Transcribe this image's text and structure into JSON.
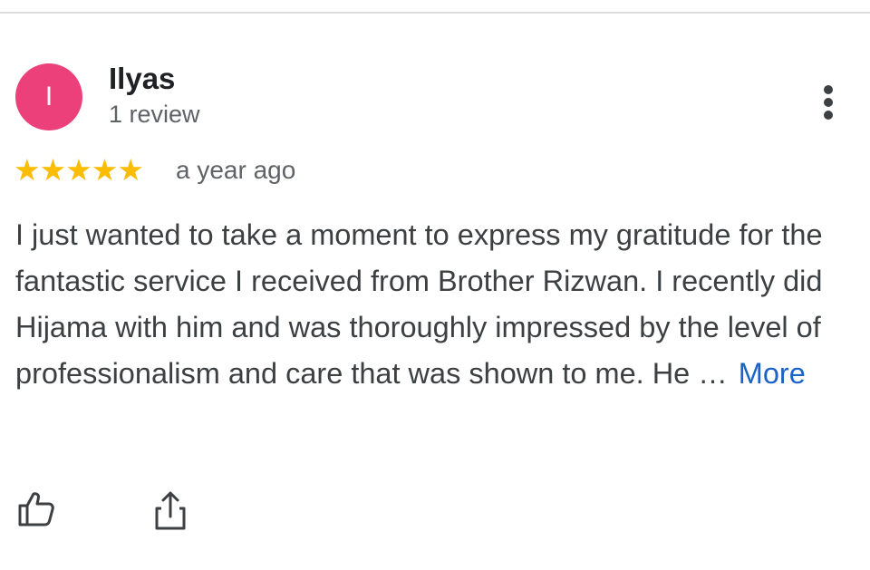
{
  "review": {
    "avatar_letter": "I",
    "avatar_color": "#ec407a",
    "reviewer_name": "Ilyas",
    "review_count": "1 review",
    "stars": "★★★★★",
    "rating": 5,
    "star_color": "#fbbc04",
    "time": "a year ago",
    "text": "I just wanted to take a moment to express my gratitude for the fantastic service I received from Brother Rizwan. I recently did Hijama with him and was thoroughly impressed by the level of professionalism and care that was shown to me. He …",
    "more_label": "More",
    "more_color": "#1a63c9"
  },
  "actions": {
    "menu_icon": "more-vert-icon",
    "like_icon": "thumbs-up-icon",
    "share_icon": "share-icon"
  }
}
